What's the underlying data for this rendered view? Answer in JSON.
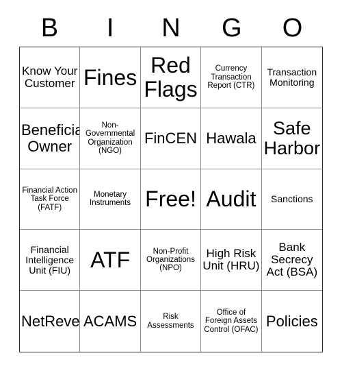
{
  "header": {
    "letters": [
      "B",
      "I",
      "N",
      "G",
      "O"
    ]
  },
  "grid": {
    "rows": 5,
    "columns": 5,
    "cells": [
      {
        "label": "Know Your Customer",
        "size": "s-md",
        "free": false
      },
      {
        "label": "Fines",
        "size": "s-xxl",
        "free": false
      },
      {
        "label": "Red Flags",
        "size": "s-xxl",
        "free": false
      },
      {
        "label": "Currency Transaction Report (CTR)",
        "size": "s-xs",
        "free": false
      },
      {
        "label": "Transaction Monitoring",
        "size": "s-sm",
        "free": false
      },
      {
        "label": "Beneficial Owner",
        "size": "s-lg",
        "free": false
      },
      {
        "label": "Non-Governmental Organization (NGO)",
        "size": "s-xs",
        "free": false
      },
      {
        "label": "FinCEN",
        "size": "s-lg",
        "free": false
      },
      {
        "label": "Hawala",
        "size": "s-lg",
        "free": false
      },
      {
        "label": "Safe Harbor",
        "size": "s-xl",
        "free": false
      },
      {
        "label": "Financial Action Task Force (FATF)",
        "size": "s-xs",
        "free": false
      },
      {
        "label": "Monetary Instruments",
        "size": "s-xs",
        "free": false
      },
      {
        "label": "Free!",
        "size": "s-xxl",
        "free": true
      },
      {
        "label": "Audit",
        "size": "s-xxl",
        "free": false
      },
      {
        "label": "Sanctions",
        "size": "s-sm",
        "free": false
      },
      {
        "label": "Financial Intelligence Unit (FIU)",
        "size": "s-sm",
        "free": false
      },
      {
        "label": "ATF",
        "size": "s-xxl",
        "free": false
      },
      {
        "label": "Non-Profit Organizations (NPO)",
        "size": "s-xs",
        "free": false
      },
      {
        "label": "High Risk Unit (HRU)",
        "size": "s-md",
        "free": false
      },
      {
        "label": "Bank Secrecy Act (BSA)",
        "size": "s-md",
        "free": false
      },
      {
        "label": "NetReveal",
        "size": "s-lg",
        "free": false
      },
      {
        "label": "ACAMS",
        "size": "s-lg",
        "free": false
      },
      {
        "label": "Risk Assessments",
        "size": "s-xs",
        "free": false
      },
      {
        "label": "Office of Foreign Assets Control (OFAC)",
        "size": "s-xs",
        "free": false
      },
      {
        "label": "Policies",
        "size": "s-lg",
        "free": false
      }
    ]
  },
  "colors": {
    "text": "#000000",
    "background": "#ffffff",
    "inner_border": "#8a8a8a",
    "outer_border": "#2b2b2b"
  }
}
